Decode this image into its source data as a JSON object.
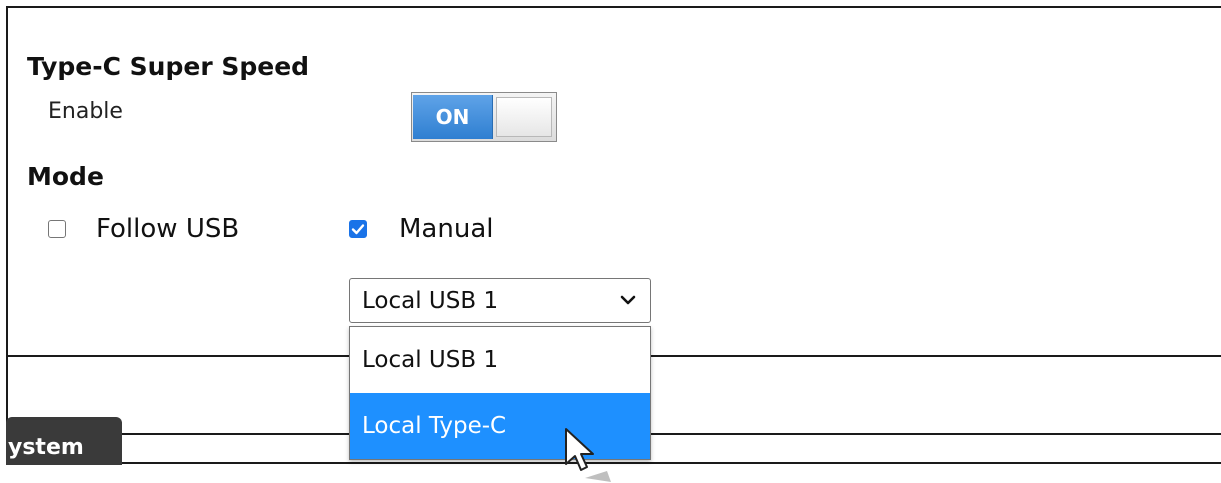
{
  "usb_section": {
    "title": "Type-C Super Speed",
    "enable_label": "Enable",
    "toggle_state": "ON"
  },
  "mode_section": {
    "title": "Mode",
    "options": [
      {
        "label": "Follow USB",
        "checked": false
      },
      {
        "label": "Manual",
        "checked": true
      }
    ],
    "select": {
      "value": "Local USB 1",
      "options": [
        "Local USB 1",
        "Local Type-C"
      ],
      "highlighted": "Local Type-C"
    }
  },
  "bottom_tab": {
    "label": "ystem"
  },
  "colors": {
    "toggle_on": "#2f7fd1",
    "dropdown_highlight": "#1e90ff",
    "checkbox_checked": "#1a73e8",
    "tab_bg": "#3a3a3a"
  }
}
